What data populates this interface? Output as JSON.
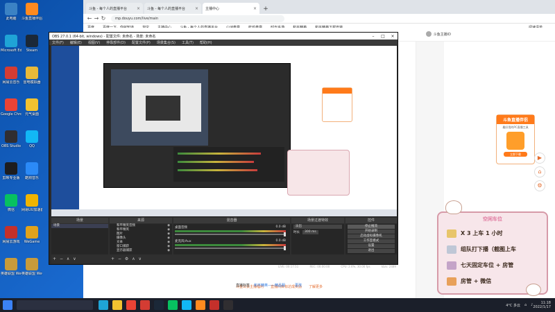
{
  "desktop": {
    "icons": [
      {
        "label": "此电脑",
        "color": "#3b82c4",
        "icon": "computer-icon"
      },
      {
        "label": "斗鱼直播伴侣",
        "color": "#ff8a1f",
        "icon": "douyu-icon"
      },
      {
        "label": "Microsoft Edge",
        "color": "#1fa4d6",
        "icon": "edge-icon"
      },
      {
        "label": "Steam",
        "color": "#1b2838",
        "icon": "steam-icon"
      },
      {
        "label": "网易云音乐",
        "color": "#d43c33",
        "icon": "netease-music-icon"
      },
      {
        "label": "雷电模拟器",
        "color": "#e8b93a",
        "icon": "emulator-icon"
      },
      {
        "label": "Google Chrome",
        "color": "#ea4335",
        "icon": "chrome-icon"
      },
      {
        "label": "元气桌面",
        "color": "#f2c230",
        "icon": "wallpaper-icon"
      },
      {
        "label": "OBS Studio",
        "color": "#302e31",
        "icon": "obs-icon"
      },
      {
        "label": "QQ",
        "color": "#12b7f5",
        "icon": "qq-icon"
      },
      {
        "label": "剪映专业版",
        "color": "#1d1d1f",
        "icon": "jianying-icon"
      },
      {
        "label": "酷狗音乐",
        "color": "#2b8af7",
        "icon": "kugou-icon"
      },
      {
        "label": "微信",
        "color": "#07c160",
        "icon": "wechat-icon"
      },
      {
        "label": "网易UU加速器",
        "color": "#f0b400",
        "icon": "uu-icon"
      },
      {
        "label": "网易云游戏",
        "color": "#c4302b",
        "icon": "cloudgame-icon"
      },
      {
        "label": "WeGame",
        "color": "#e0a21c",
        "icon": "wegame-icon"
      },
      {
        "label": "英雄联盟 WeGame版",
        "color": "#c79b3b",
        "icon": "lol-icon"
      },
      {
        "label": "英雄联盟 WeGame版",
        "color": "#c79b3b",
        "icon": "lol-icon"
      }
    ]
  },
  "browser": {
    "tabs": [
      {
        "title": "斗鱼 - 每个人的直播平台",
        "active": false
      },
      {
        "title": "斗鱼 - 每个人的直播平台",
        "active": false
      },
      {
        "title": "主播中心",
        "active": true
      }
    ],
    "url": "mp.douyu.com/live/main",
    "bookmarks": [
      "百度",
      "百度一下，你就知道",
      "淘宝",
      "主播中心",
      "斗鱼 - 每个人的直播平台",
      "山河奏章",
      "吃鸡奏章",
      "时光手游",
      "和平精英",
      "和平精英下载安装",
      "阅读清单"
    ],
    "owner_name": "斗鱼主播ID",
    "bottom_links": [
      "斗鱼公会主播福利",
      "直播间目标达成奖励",
      "了解更多"
    ],
    "footer": {
      "left": "直播标签",
      "link": "和平精英——精品服",
      "right": "更改"
    },
    "promo": {
      "title": "斗鱼直播伴侣",
      "subtitle": "最好用的PC直播工具",
      "button": "立即下载"
    }
  },
  "obs": {
    "title": "OBS 27.0.1 (64-bit, windows) - 配置文件: 未命名 - 场景: 未命名",
    "menu": [
      "文件(F)",
      "编辑(E)",
      "视图(V)",
      "停靠部件(D)",
      "配置文件(P)",
      "场景集合(S)",
      "工具(T)",
      "帮助(H)"
    ],
    "dock_headers": {
      "scenes": "场景",
      "sources": "来源",
      "mixer": "混音器",
      "transitions": "场景过渡特效",
      "controls": "控件"
    },
    "scenes": [
      "场景"
    ],
    "sources": [
      "和平精英音频",
      "和平精英",
      "图片",
      "摄像头",
      "文本",
      "窗口捕获",
      "显示器捕获"
    ],
    "mixer": [
      {
        "name": "桌面音频",
        "db": "0.0 dB"
      },
      {
        "name": "麦克风/Aux",
        "db": "0.0 dB"
      }
    ],
    "transition": {
      "type": "淡出",
      "duration_label": "时长",
      "duration": "300 ms"
    },
    "controls": [
      {
        "label": "停止推流",
        "active": true
      },
      {
        "label": "开始录制",
        "active": false
      },
      {
        "label": "启动虚拟摄像机",
        "active": false
      },
      {
        "label": "工作室模式",
        "active": false
      },
      {
        "label": "设置",
        "active": false
      },
      {
        "label": "退出",
        "active": false
      }
    ],
    "status": {
      "live": "LIVE: 00:17:51",
      "rec": "REC: 00:00:00",
      "cpu": "CPU: 2.6%, 30.00 fps",
      "kbps": "kb/s: 2489"
    }
  },
  "overlay": {
    "title": "空闲车位",
    "rows": [
      {
        "text": "X 3 上车 1 小时",
        "color": "#e8c56a"
      },
      {
        "text": "组队打下播（截图上车",
        "color": "#bfc7d6"
      },
      {
        "text": "七天固定车位 + 房管",
        "color": "#c4a4c8"
      },
      {
        "text": "房管 + 微信",
        "color": "#e8a05a"
      }
    ]
  },
  "taskbar": {
    "apps": [
      {
        "icon": "edge-icon",
        "color": "#1fa4d6"
      },
      {
        "icon": "explorer-icon",
        "color": "#f2c230"
      },
      {
        "icon": "chrome-icon",
        "color": "#ea4335"
      },
      {
        "icon": "netease-music-icon",
        "color": "#d43c33"
      },
      {
        "icon": "steam-icon",
        "color": "#1b2838"
      },
      {
        "icon": "wechat-icon",
        "color": "#07c160"
      },
      {
        "icon": "qq-icon",
        "color": "#12b7f5"
      },
      {
        "icon": "douyu-icon",
        "color": "#ff8a1f"
      },
      {
        "icon": "netease-cloud-icon",
        "color": "#c4302b"
      },
      {
        "icon": "obs-icon",
        "color": "#302e31"
      }
    ],
    "weather": "4°C 多云",
    "time": "11:18",
    "date": "2022/1/17"
  }
}
